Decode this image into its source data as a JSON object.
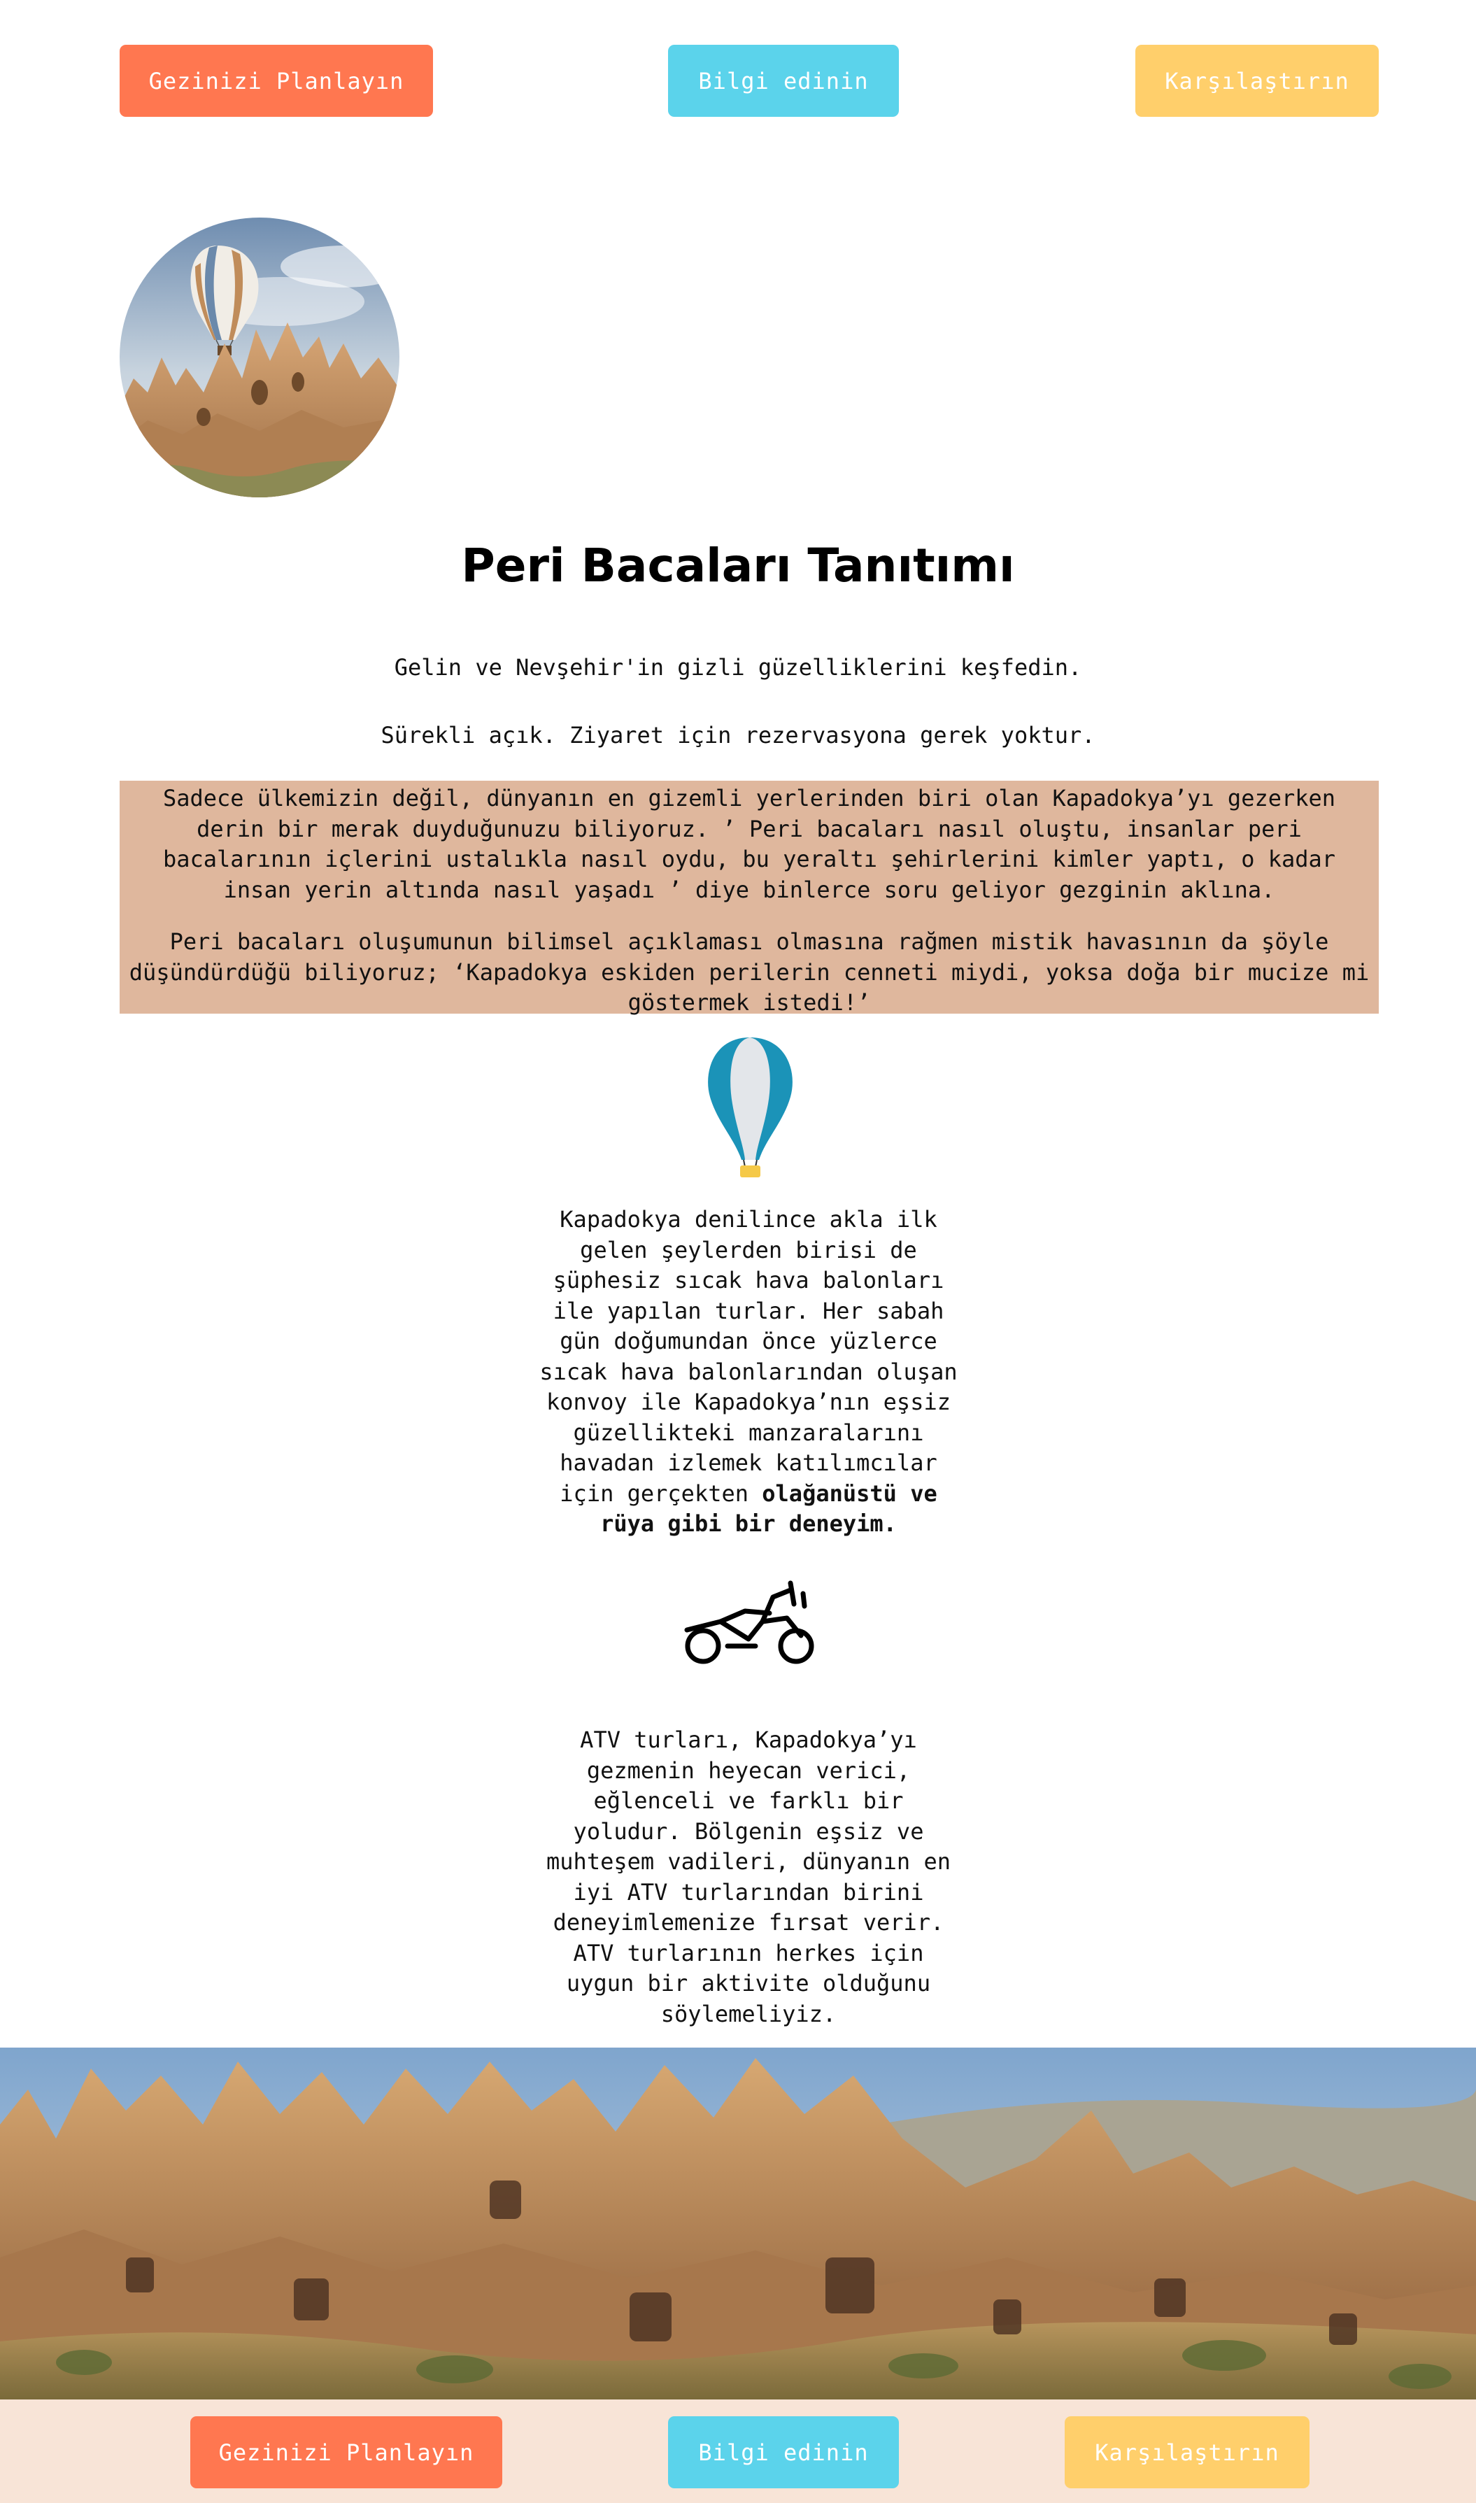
{
  "nav": {
    "plan_label": "Gezinizi Planlayın",
    "info_label": "Bilgi edinin",
    "compare_label": "Karşılaştırın"
  },
  "hero": {
    "image_name": "hot-air-balloon-over-fairy-chimneys"
  },
  "page_title": "Peri Bacaları Tanıtımı",
  "tagline": "Gelin ve Nevşehir'in gizli güzelliklerini keşfedin.",
  "open_note": "Sürekli açık. Ziyaret için rezervasyona gerek yoktur.",
  "intro": {
    "paragraph_1": "Sadece ülkemizin değil, dünyanın en gizemli yerlerinden biri olan Kapadokya’yı gezerken derin bir merak duyduğunuzu biliyoruz. ’ Peri bacaları nasıl oluştu, insanlar peri bacalarının içlerini ustalıkla nasıl oydu, bu yeraltı şehirlerini kimler yaptı, o kadar insan yerin altında nasıl yaşadı ’ diye binlerce soru geliyor gezginin aklına.",
    "paragraph_2": "Peri bacaları oluşumunun bilimsel açıklaması olmasına rağmen mistik havasının da şöyle düşündürdüğü biliyoruz; ‘Kapadokya eskiden perilerin cenneti miydi, yoksa doğa bir mucize mi göstermek istedi!’"
  },
  "balloon": {
    "icon": "hot-air-balloon-icon",
    "text": "Kapadokya denilince akla ilk gelen şeylerden birisi de şüphesiz sıcak hava balonları ile yapılan turlar. Her sabah gün doğumundan önce yüzlerce sıcak hava balonlarından oluşan konvoy ile Kapadokya’nın eşsiz güzellikteki manzaralarını havadan izlemek katılımcılar için gerçekten",
    "emphasis": "olağanüstü ve rüya gibi bir deneyim."
  },
  "atv": {
    "icon": "atv-motorcycle-icon",
    "text": "ATV turları, Kapadokya’yı gezmenin heyecan verici, eğlenceli ve farklı bir yoludur. Bölgenin eşsiz ve muhteşem vadileri, dünyanın en iyi ATV turlarından birini deneyimlemenize fırsat verir. ATV turlarının herkes için uygun bir aktivite olduğunu söylemeliyiz."
  },
  "banner": {
    "image_name": "fairy-chimneys-landscape"
  },
  "footer": {
    "plan_label": "Gezinizi Planlayın",
    "info_label": "Bilgi edinin",
    "compare_label": "Karşılaştırın"
  },
  "colors": {
    "orange": "#ff7750",
    "cyan": "#5bd3eb",
    "yellow": "#ffcf6b",
    "intro_bg": "#dfb79d",
    "footer_bg": "#f8e4d7"
  }
}
